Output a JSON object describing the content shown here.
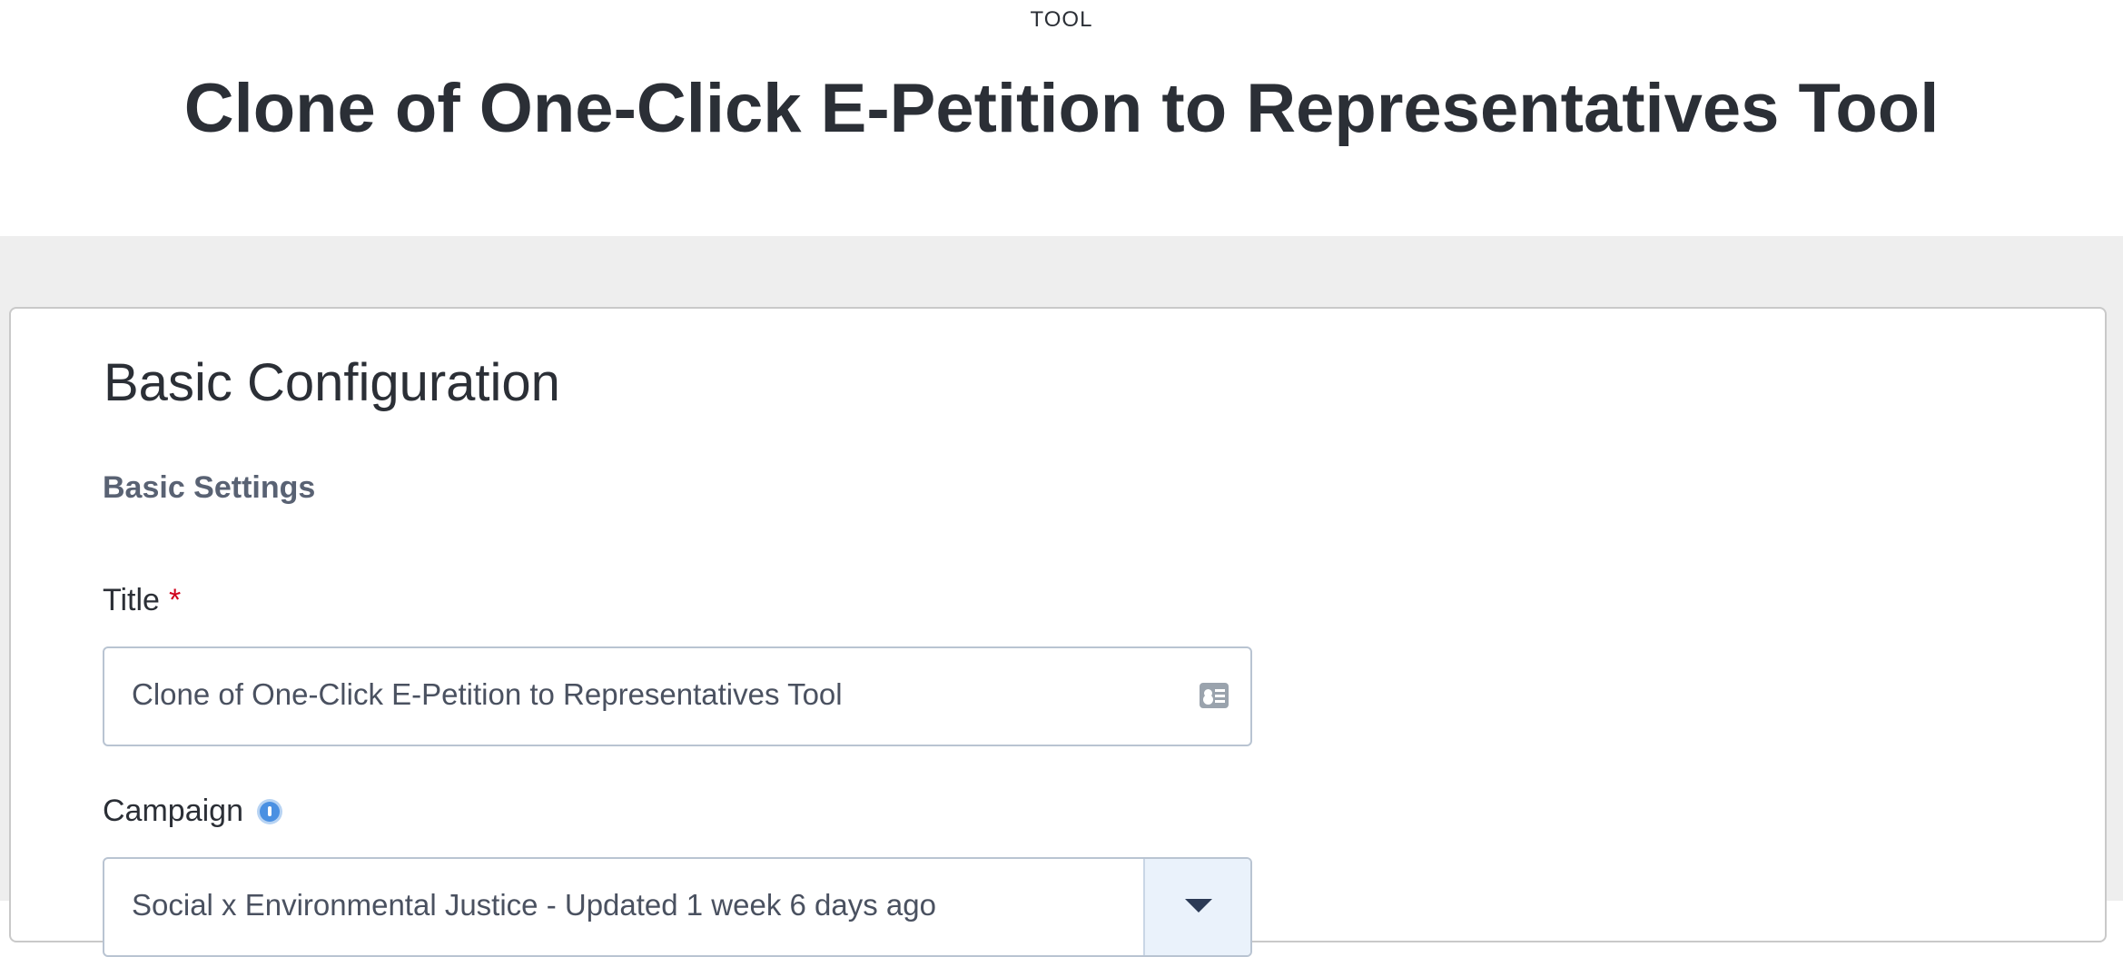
{
  "header": {
    "eyebrow": "TOOL",
    "title": "Clone of One-Click E-Petition to Representatives Tool"
  },
  "main": {
    "section_heading": "Basic Configuration",
    "subsection_heading": "Basic Settings",
    "fields": {
      "title": {
        "label": "Title",
        "required_marker": "*",
        "value": "Clone of One-Click E-Petition to Representatives Tool",
        "icon": "contact-card-icon"
      },
      "campaign": {
        "label": "Campaign",
        "help_icon": "info-icon",
        "value": "Social x Environmental Justice - Updated 1 week 6 days ago"
      }
    }
  },
  "colors": {
    "required": "#d0021b",
    "info": "#4a90e2",
    "page_background": "#eeeeee"
  }
}
